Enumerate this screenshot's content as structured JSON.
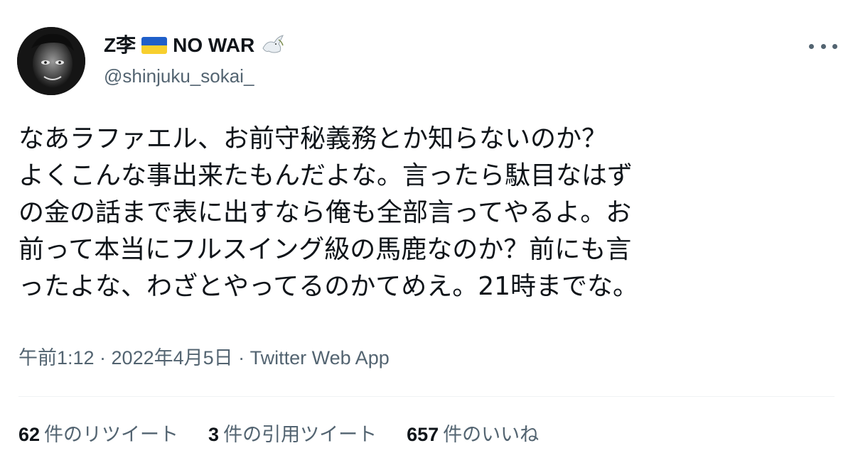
{
  "user": {
    "display_name": "Z李",
    "display_suffix": "NO WAR",
    "handle": "@shinjuku_sokai_",
    "badges": [
      "ukraine-flag-icon",
      "dove-icon"
    ]
  },
  "tweet": {
    "lines": [
      "なあラファエル、お前守秘義務とか知らないのか？",
      "よくこんな事出来たもんだよな。言ったら駄目なはず",
      "の金の話まで表に出すなら俺も全部言ってやるよ。お",
      "前って本当にフルスイング級の馬鹿なのか？前にも言",
      "ったよな、わざとやってるのかてめえ。21時までな。"
    ]
  },
  "meta": {
    "text": "午前1:12 · 2022年4月5日 · Twitter Web App"
  },
  "stats": [
    {
      "count": "62",
      "label": "件のリツイート"
    },
    {
      "count": "3",
      "label": "件の引用ツイート"
    },
    {
      "count": "657",
      "label": "件のいいね"
    }
  ],
  "colors": {
    "text": "#0f1419",
    "secondary": "#536471",
    "flag_blue": "#1f5fc9",
    "flag_yellow": "#f7cf2e"
  }
}
